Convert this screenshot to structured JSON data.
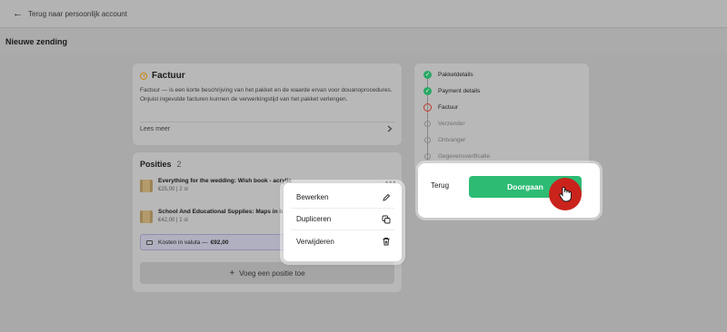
{
  "topbar": {
    "back_label": "Terug naar persoonlijk account"
  },
  "page": {
    "title": "Nieuwe zending"
  },
  "factuur": {
    "title": "Factuur",
    "description": "Factuur — is een korte beschrijving van het pakket en de waarde ervan voor douanoprocedures. Onjuist ingevulde facturen kunnen de verwerkingstijd van het pakket verlengen.",
    "read_more": "Lees meer"
  },
  "posities": {
    "title": "Posities",
    "count": "2",
    "items": [
      {
        "name": "Everything for the wedding: Wish book - acrylic",
        "meta": "€25,00 | 2 st"
      },
      {
        "name": "School And Educational Supplies: Maps in b",
        "meta": "€42,00 | 1 st"
      }
    ],
    "kosten_label": "Kosten in valuta —",
    "kosten_value": "€92,00",
    "add_label": "Voeg een positie toe"
  },
  "context_menu": {
    "items": [
      {
        "label": "Bewerken",
        "icon": "pencil-icon"
      },
      {
        "label": "Dupliceren",
        "icon": "copy-icon"
      },
      {
        "label": "Verwijderen",
        "icon": "trash-icon"
      }
    ]
  },
  "steps": [
    {
      "label": "Pakketdetails",
      "state": "done"
    },
    {
      "label": "Payment details",
      "state": "done"
    },
    {
      "label": "Factuur",
      "state": "current"
    },
    {
      "label": "Verzender",
      "state": "todo"
    },
    {
      "label": "Ontvanger",
      "state": "todo"
    },
    {
      "label": "Gegevensverificatie",
      "state": "todo"
    }
  ],
  "actions": {
    "back_label": "Terug",
    "continue_label": "Doorgaan"
  },
  "colors": {
    "accent_green": "#2dbb74",
    "current_step_red": "#c0392b",
    "cursor_red": "#c9231c"
  }
}
